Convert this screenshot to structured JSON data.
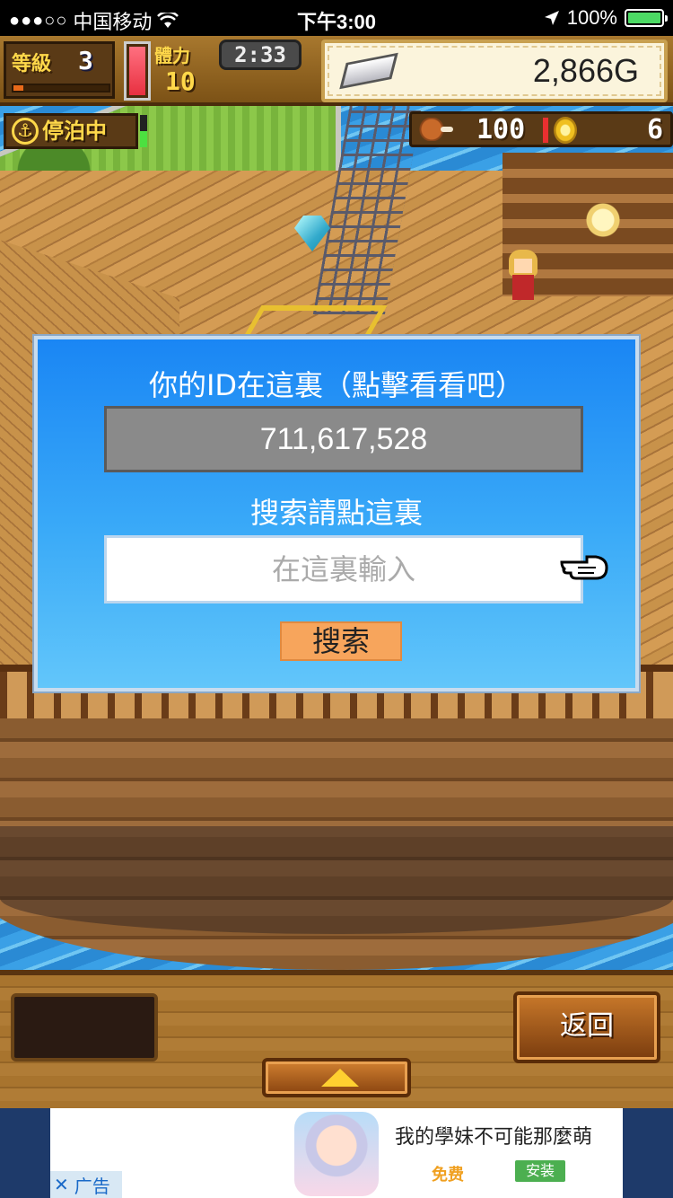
{
  "status_bar": {
    "signal": "●●●○○",
    "carrier": "中国移动",
    "time": "下午3:00",
    "battery": "100%"
  },
  "hud": {
    "level_label": "等級",
    "level": "3",
    "exp_fraction": 0.1,
    "stamina_fraction": 1.0,
    "stamina_label": "體力",
    "stamina": "10",
    "timer": "2:33",
    "gold": "2,866G",
    "status_badge": "停泊中",
    "food": "100",
    "coins": "6"
  },
  "dialog": {
    "title": "你的ID在這裏（點擊看看吧）",
    "player_id": "711,617,528",
    "search_label": "搜索請點這裏",
    "input_placeholder": "在這裏輸入",
    "search_button": "搜索"
  },
  "bottom": {
    "back_button": "返回"
  },
  "ad": {
    "title": "我的學妹不可能那麼萌",
    "free": "免费",
    "install": "安装",
    "label": "广告",
    "close": "✕"
  },
  "colors": {
    "dialog_top": "#1a86f4",
    "dialog_bottom": "#62c6fa",
    "search_button": "#f7a55c",
    "id_box": "#8a8a8a"
  }
}
